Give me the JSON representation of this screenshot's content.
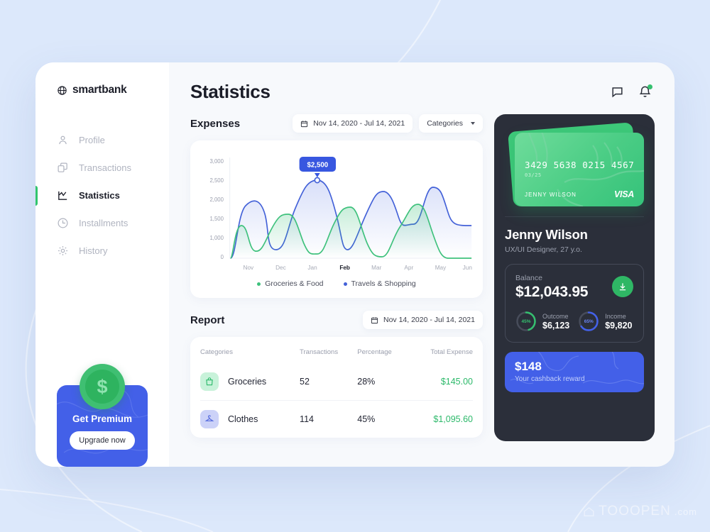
{
  "brand": {
    "name": "smartbank",
    "logo_icon": "globe-icon"
  },
  "sidebar": {
    "items": [
      {
        "label": "Profile",
        "icon": "user-icon",
        "active": false
      },
      {
        "label": "Transactions",
        "icon": "copy-icon",
        "active": false
      },
      {
        "label": "Statistics",
        "icon": "line-chart-icon",
        "active": true
      },
      {
        "label": "Installments",
        "icon": "clock-icon",
        "active": false
      },
      {
        "label": "History",
        "icon": "gear-icon",
        "active": false
      }
    ],
    "promo": {
      "title": "Get Premium",
      "button": "Upgrade now",
      "icon": "dollar-coin-icon"
    }
  },
  "header": {
    "title": "Statistics",
    "message_icon": "message-icon",
    "bell_icon": "bell-icon",
    "has_notification": true
  },
  "expenses": {
    "title": "Expenses",
    "date_range": "Nov 14, 2020 - Jul 14, 2021",
    "date_icon": "calendar-icon",
    "filter_label": "Categories",
    "filter_caret": "chevron-down-icon",
    "tooltip": "$2,500"
  },
  "chart_data": {
    "type": "area",
    "title": "Expenses",
    "xlabel": "",
    "ylabel": "",
    "categories": [
      "Nov",
      "Dec",
      "Jan",
      "Feb",
      "Mar",
      "Apr",
      "May",
      "Jun"
    ],
    "active_category": "Feb",
    "ylim": [
      0,
      3000
    ],
    "yticks": [
      "3,000",
      "2,500",
      "2,000",
      "1,500",
      "1,000",
      "0"
    ],
    "ytick_values": [
      3000,
      2500,
      2000,
      1500,
      1000,
      0
    ],
    "grid": false,
    "legend_position": "bottom",
    "annotation": {
      "label": "$2,500",
      "category": "Feb",
      "value": 2500,
      "series": "Travels & Shopping"
    },
    "series": [
      {
        "name": "Groceries & Food",
        "color": "#3ec17c",
        "values": [
          1200,
          250,
          1520,
          180,
          1700,
          60,
          1800,
          0
        ]
      },
      {
        "name": "Travels & Shopping",
        "color": "#4361d8",
        "values": [
          1930,
          250,
          2500,
          800,
          2200,
          1520,
          2080,
          1430
        ]
      }
    ]
  },
  "report": {
    "title": "Report",
    "date_range": "Nov 14, 2020 - Jul 14, 2021",
    "date_icon": "calendar-icon",
    "columns": [
      "Categories",
      "Transactions",
      "Percentage",
      "Total Expense"
    ],
    "rows": [
      {
        "category": "Groceries",
        "icon": "shopping-bag-icon",
        "icon_bg": "#c8f2da",
        "icon_color": "#2cb96a",
        "transactions": "52",
        "percentage": "28%",
        "total": "$145.00"
      },
      {
        "category": "Clothes",
        "icon": "hanger-icon",
        "icon_bg": "#ccd2f8",
        "icon_color": "#5268dd",
        "transactions": "114",
        "percentage": "45%",
        "total": "$1,095.60"
      }
    ]
  },
  "profile_panel": {
    "card": {
      "number": "3429 5638 0215 4567",
      "expiry": "03/25",
      "holder": "JENNY WILSON",
      "network": "VISA"
    },
    "name": "Jenny Wilson",
    "role": "UX/UI Designer, 27 y.o.",
    "balance": {
      "label": "Balance",
      "amount": "$12,043.95",
      "download_icon": "download-icon"
    },
    "stats": [
      {
        "name": "Outcome",
        "value": "$6,123",
        "percent": "45%",
        "percent_num": 45,
        "color": "#35c06f"
      },
      {
        "name": "Income",
        "value": "$9,820",
        "percent": "65%",
        "percent_num": 65,
        "color": "#4361ea"
      }
    ],
    "cashback": {
      "amount": "$148",
      "label": "Your cashback reward"
    }
  },
  "watermark": {
    "text": "TOOOPEN",
    "suffix": ".com",
    "icon": "home-icon"
  },
  "colors": {
    "accent_blue": "#4360e8",
    "accent_green": "#31c56d",
    "panel_dark": "#2b2f3a",
    "page_bg": "#dce8fb"
  }
}
